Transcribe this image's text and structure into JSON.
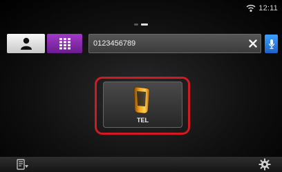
{
  "status": {
    "time": "12:11",
    "wifi_icon": "wifi-icon"
  },
  "pager": {
    "pages": 2,
    "active": 2
  },
  "tabs": {
    "contacts_icon": "contact-person-icon",
    "keypad_icon": "keypad-grid-icon"
  },
  "dial": {
    "number": "0123456789",
    "clear_icon": "close-icon",
    "mic_icon": "microphone-icon"
  },
  "tel": {
    "label": "TEL",
    "icon": "phone-handset-icon"
  },
  "bottom": {
    "left_icon": "menu-icon",
    "right_icon": "gear-icon"
  },
  "colors": {
    "keypad_accent": "#8a2bb8",
    "highlight": "#d21a22",
    "mic_accent": "#2a7de0"
  }
}
